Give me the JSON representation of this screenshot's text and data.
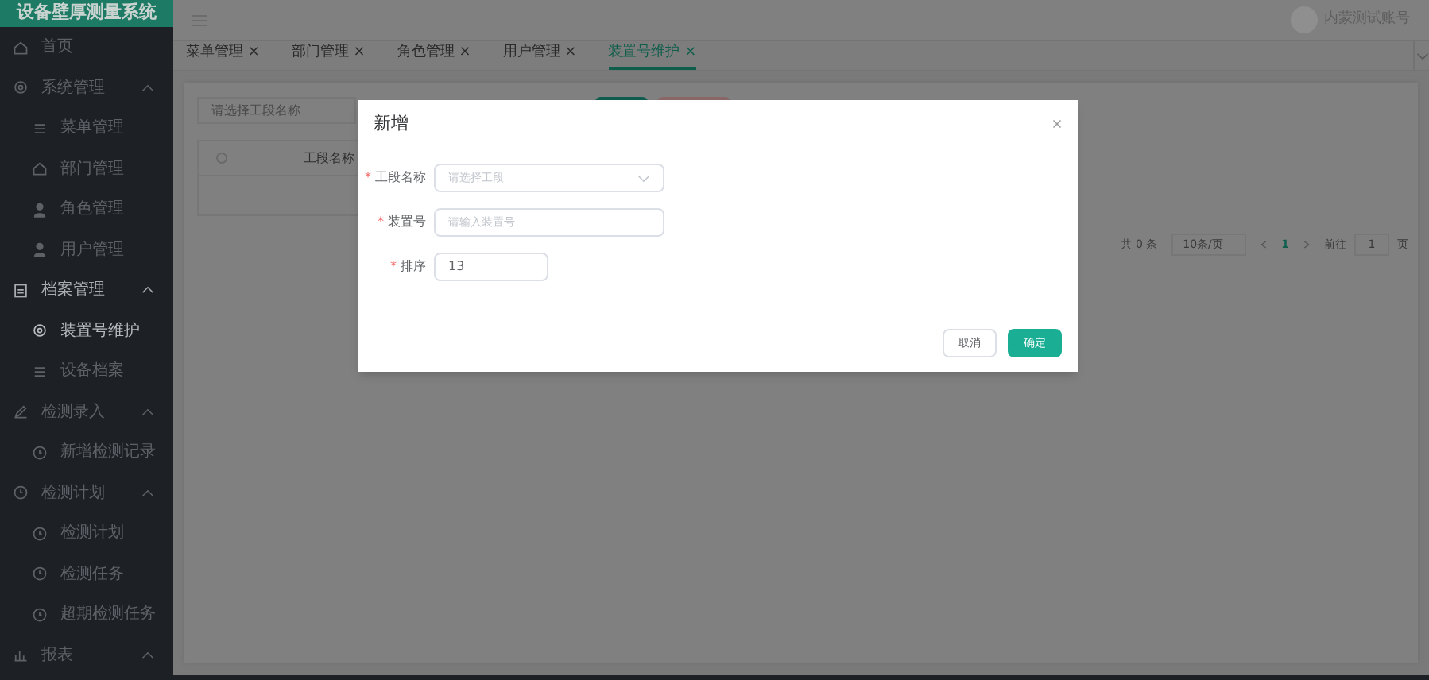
{
  "app": {
    "title": "设备壁厚测量系统",
    "user": "内蒙测试账号"
  },
  "sidebar": {
    "items": [
      {
        "label": "首页"
      },
      {
        "label": "系统管理",
        "expanded": true,
        "selected": false,
        "children": [
          {
            "label": "菜单管理",
            "selected": false
          },
          {
            "label": "部门管理",
            "selected": false
          },
          {
            "label": "角色管理",
            "selected": false
          },
          {
            "label": "用户管理",
            "selected": false
          }
        ]
      },
      {
        "label": "档案管理",
        "expanded": true,
        "selected": true,
        "children": [
          {
            "label": "装置号维护",
            "selected": true
          },
          {
            "label": "设备档案",
            "selected": false
          }
        ]
      },
      {
        "label": "检测录入",
        "expanded": true,
        "selected": false,
        "children": [
          {
            "label": "新增检测记录",
            "selected": false
          }
        ]
      },
      {
        "label": "检测计划",
        "expanded": true,
        "selected": false,
        "children": [
          {
            "label": "检测计划",
            "selected": false
          },
          {
            "label": "检测任务",
            "selected": false
          },
          {
            "label": "超期检测任务",
            "selected": false
          }
        ]
      },
      {
        "label": "报表",
        "expanded": true,
        "selected": false
      }
    ]
  },
  "tabs": [
    {
      "label": "菜单管理",
      "close": "×",
      "selected": false
    },
    {
      "label": "部门管理",
      "close": "×",
      "selected": false
    },
    {
      "label": "角色管理",
      "close": "×",
      "selected": false
    },
    {
      "label": "用户管理",
      "close": "×",
      "selected": false
    },
    {
      "label": "装置号维护",
      "close": "×",
      "selected": true
    }
  ],
  "filter": {
    "placeholder": "请选择工段名称"
  },
  "table": {
    "select_all_checked": false,
    "columns": [
      "工段名称"
    ]
  },
  "pagination": {
    "total": "共 0 条",
    "page_size": "10条/页",
    "current": "1",
    "goto_label": "前往",
    "goto_value": "1",
    "page_unit": "页"
  },
  "dialog": {
    "title": "新增",
    "fields": [
      {
        "required_mark": "*",
        "label": "工段名称",
        "kind": "select",
        "placeholder": "请选择工段"
      },
      {
        "required_mark": "*",
        "label": "装置号",
        "kind": "input",
        "placeholder": "请输入装置号"
      },
      {
        "required_mark": "*",
        "label": "排序",
        "kind": "number",
        "value": "13"
      }
    ],
    "buttons": [
      {
        "label": "取消",
        "kind": "default"
      },
      {
        "label": "确定",
        "kind": "primary"
      }
    ]
  }
}
